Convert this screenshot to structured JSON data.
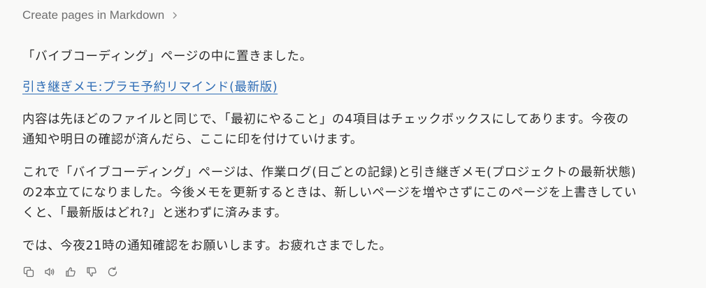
{
  "breadcrumb": {
    "label": "Create pages in Markdown"
  },
  "message": {
    "p1": "「バイブコーディング」ページの中に置きました。",
    "link_text": "引き継ぎメモ:プラモ予約リマインド(最新版)",
    "p3": "内容は先ほどのファイルと同じで、「最初にやること」の4項目はチェックボックスにしてあります。今夜の通知や明日の確認が済んだら、ここに印を付けていけます。",
    "p4": "これで「バイブコーディング」ページは、作業ログ(日ごとの記録)と引き継ぎメモ(プロジェクトの最新状態)の2本立てになりました。今後メモを更新するときは、新しいページを増やさずにこのページを上書きしていくと、「最新版はどれ?」と迷わずに済みます。",
    "p5": "では、今夜21時の通知確認をお願いします。お疲れさまでした。"
  },
  "actions": [
    {
      "icon": "copy-icon"
    },
    {
      "icon": "speaker-icon"
    },
    {
      "icon": "thumbs-up-icon"
    },
    {
      "icon": "thumbs-down-icon"
    },
    {
      "icon": "retry-icon"
    }
  ],
  "colors": {
    "text": "#2b2b2b",
    "muted": "#6f6f6f",
    "link": "#2f6db5",
    "background": "#f9f9f8"
  }
}
